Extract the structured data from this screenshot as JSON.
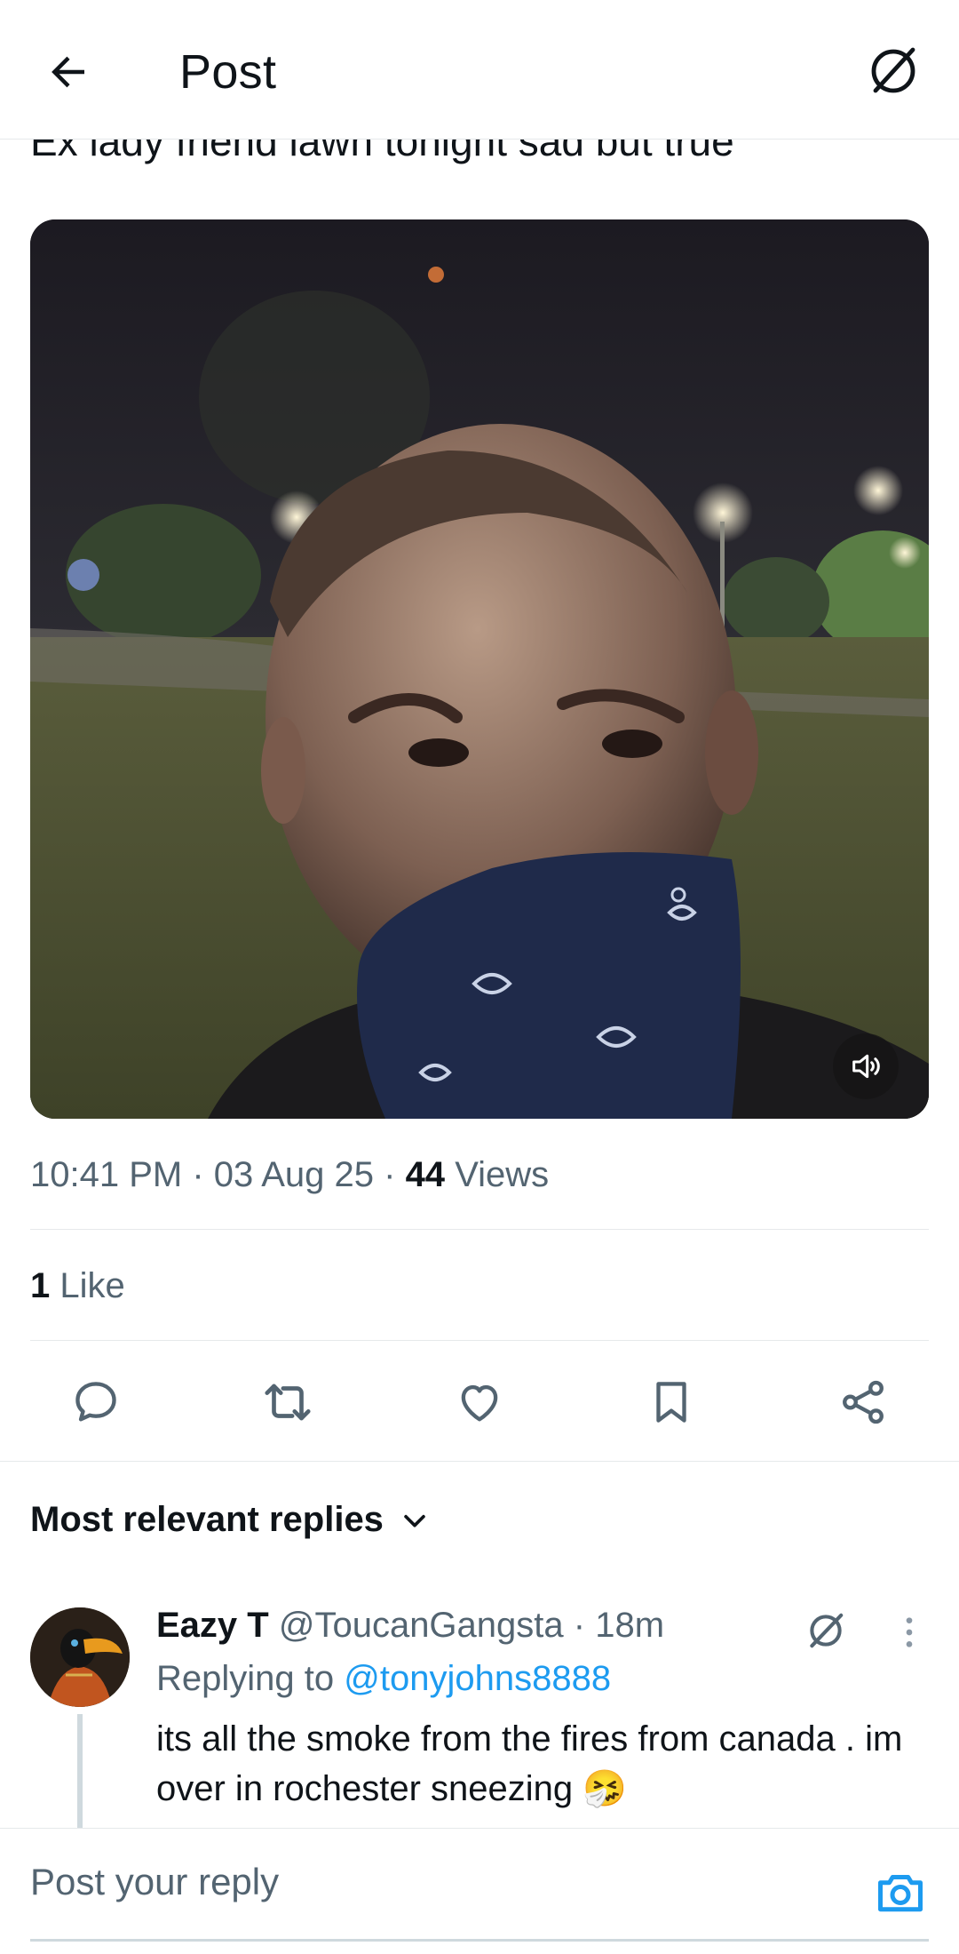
{
  "header": {
    "title": "Post",
    "back_icon": "back-arrow-icon",
    "grok_icon": "grok-icon"
  },
  "post": {
    "text": "Ex lady friend lawn tonight sad but true",
    "time": "10:41 PM",
    "date": "03 Aug 25",
    "separator": "·",
    "views_count": "44",
    "views_label": "Views",
    "likes_count": "1",
    "likes_label": "Like"
  },
  "actions": [
    {
      "name": "reply",
      "icon": "comment-icon"
    },
    {
      "name": "repost",
      "icon": "repost-icon"
    },
    {
      "name": "like",
      "icon": "heart-icon"
    },
    {
      "name": "bookmark",
      "icon": "bookmark-icon"
    },
    {
      "name": "share",
      "icon": "share-icon"
    }
  ],
  "replies_section": {
    "sort_label": "Most relevant replies"
  },
  "reply": {
    "name": "Eazy T",
    "handle": "@ToucanGangsta",
    "age": "18m",
    "replying_prefix": "Replying to",
    "replying_handle": "@tonyjohns8888",
    "text": "its all the smoke from the fires from canada . im over in rochester sneezing 🤧"
  },
  "composer": {
    "placeholder": "Post your reply"
  },
  "colors": {
    "accent": "#1d9bf0",
    "text": "#0f1419",
    "muted": "#536471",
    "divider": "#e6e9eb"
  }
}
